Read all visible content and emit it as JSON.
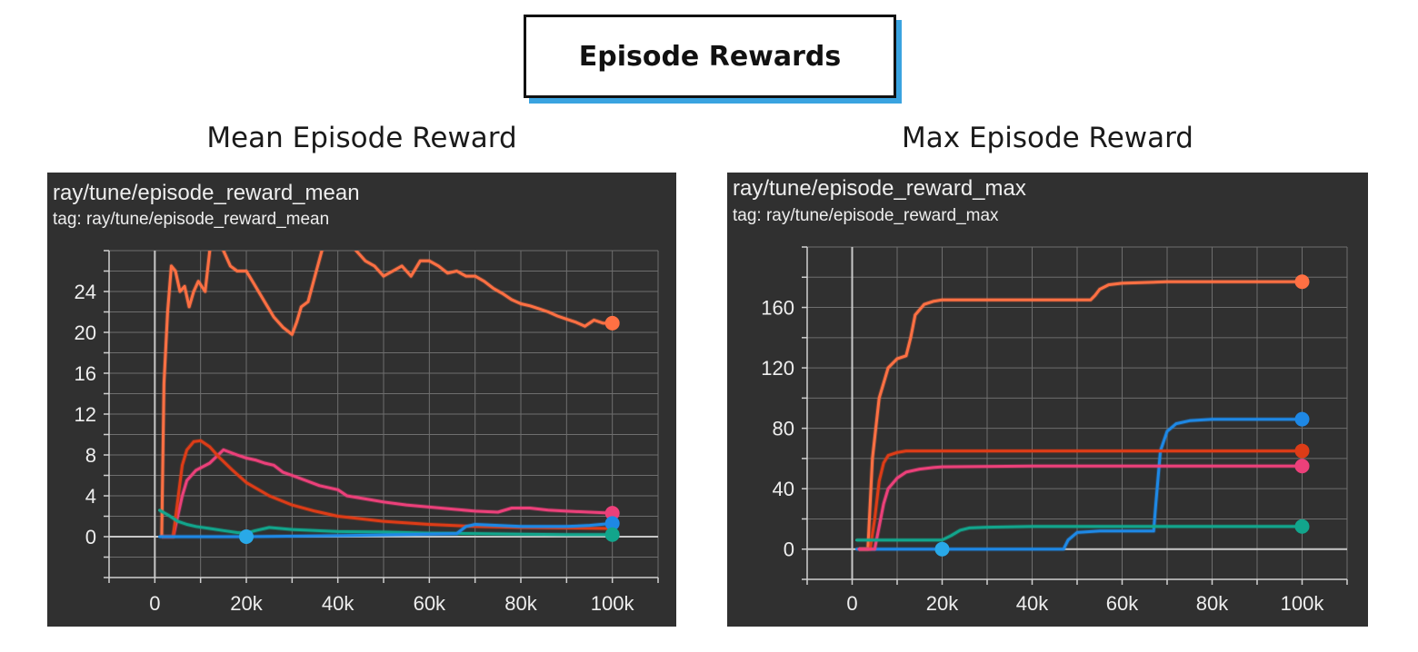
{
  "header": {
    "title": "Episode Rewards"
  },
  "colors": {
    "panel_bg": "#303030",
    "grid": "#6e6e6e",
    "axis": "#d0d0d0",
    "text": "#eeeeee",
    "title_shadow": "#3aa3e0"
  },
  "chart_data": [
    {
      "type": "line",
      "heading": "Mean Episode Reward",
      "title": "ray/tune/episode_reward_mean",
      "subtitle": "tag: ray/tune/episode_reward_mean",
      "xlim": [
        -10000,
        110000
      ],
      "ylim": [
        -4,
        28
      ],
      "x_ticks": [
        0,
        20000,
        40000,
        60000,
        80000,
        100000
      ],
      "x_tick_labels": [
        "0",
        "20k",
        "40k",
        "60k",
        "80k",
        "100k"
      ],
      "y_ticks": [
        0,
        4,
        8,
        12,
        16,
        20,
        24
      ],
      "y_tick_labels": [
        "0",
        "4",
        "8",
        "12",
        "16",
        "20",
        "24"
      ],
      "grid": true,
      "series": [
        {
          "color": "#ff7043",
          "x": [
            1500,
            2000,
            2800,
            3600,
            4500,
            5500,
            6500,
            7500,
            8500,
            9500,
            11000,
            12500,
            13500,
            15000,
            16500,
            18000,
            20000,
            22000,
            24000,
            26000,
            28000,
            30000,
            31000,
            32000,
            33500,
            35000,
            36500,
            38000,
            40000,
            42000,
            44000,
            46000,
            48000,
            50000,
            52000,
            54000,
            56000,
            58000,
            60000,
            62000,
            64000,
            66000,
            68000,
            70000,
            72000,
            74000,
            76000,
            78000,
            80000,
            82000,
            84000,
            86000,
            88000,
            90000,
            92000,
            94000,
            96000,
            98000,
            100000
          ],
          "y": [
            0,
            15,
            22,
            26.5,
            26,
            24,
            24.5,
            22.5,
            24,
            25,
            24,
            30,
            32,
            28,
            26.5,
            26,
            26,
            24.5,
            23,
            21.5,
            20.5,
            19.8,
            21,
            22.5,
            23,
            25.5,
            28,
            32,
            32,
            30,
            28,
            27,
            26.5,
            25.5,
            26,
            26.5,
            25.5,
            27,
            27,
            26.5,
            25.8,
            26,
            25.5,
            25.5,
            25,
            24.3,
            23.8,
            23.2,
            22.8,
            22.6,
            22.3,
            22,
            21.6,
            21.3,
            21,
            20.6,
            21.2,
            20.9,
            20.9
          ]
        },
        {
          "color": "#ec407a",
          "x": [
            1500,
            4000,
            5000,
            6000,
            7000,
            9000,
            12000,
            15000,
            18000,
            20000,
            22000,
            24000,
            26000,
            28000,
            30000,
            33000,
            36000,
            40000,
            42000,
            46000,
            50000,
            55000,
            60000,
            65000,
            70000,
            75000,
            78000,
            82000,
            86000,
            90000,
            95000,
            100000
          ],
          "y": [
            0,
            0,
            2,
            4,
            5.5,
            6.5,
            7.2,
            8.5,
            8.0,
            7.7,
            7.5,
            7.2,
            7.0,
            6.3,
            6.0,
            5.5,
            5.0,
            4.6,
            4.0,
            3.7,
            3.4,
            3.1,
            2.9,
            2.7,
            2.5,
            2.4,
            2.8,
            2.8,
            2.6,
            2.5,
            2.4,
            2.3
          ]
        },
        {
          "color": "#dd3c17",
          "x": [
            1500,
            4000,
            5000,
            6000,
            7000,
            8500,
            10000,
            12000,
            14000,
            17000,
            20000,
            25000,
            30000,
            35000,
            40000,
            50000,
            60000,
            70000,
            80000,
            90000,
            100000
          ],
          "y": [
            0,
            0,
            3.5,
            7.0,
            8.5,
            9.3,
            9.4,
            8.8,
            7.8,
            6.5,
            5.3,
            4.0,
            3.1,
            2.5,
            2.0,
            1.5,
            1.2,
            1.0,
            0.9,
            0.85,
            0.8
          ]
        },
        {
          "color": "#12a58c",
          "x": [
            1000,
            3000,
            5000,
            7000,
            9000,
            12000,
            15000,
            18000,
            20000,
            22000,
            25000,
            30000,
            40000,
            50000,
            60000,
            70000,
            80000,
            90000,
            100000
          ],
          "y": [
            2.6,
            2.1,
            1.5,
            1.2,
            1.0,
            0.8,
            0.6,
            0.4,
            0.35,
            0.6,
            0.9,
            0.7,
            0.5,
            0.45,
            0.35,
            0.3,
            0.25,
            0.2,
            0.2
          ]
        },
        {
          "color": "#1e88e5",
          "x": [
            1000,
            20000,
            40000,
            60000,
            66000,
            68000,
            70000,
            80000,
            90000,
            95000,
            100000
          ],
          "y": [
            0,
            0,
            0.1,
            0.25,
            0.3,
            1.0,
            1.2,
            1.0,
            1.0,
            1.1,
            1.3
          ]
        }
      ],
      "markers": [
        {
          "x": 100000,
          "y": 20.9,
          "color": "#ff7043"
        },
        {
          "x": 100000,
          "y": 2.3,
          "color": "#ec407a"
        },
        {
          "x": 100000,
          "y": 1.3,
          "color": "#1e88e5"
        },
        {
          "x": 100000,
          "y": 0.2,
          "color": "#12a58c"
        },
        {
          "x": 20000,
          "y": 0,
          "color": "#29a9e8"
        }
      ]
    },
    {
      "type": "line",
      "heading": "Max Episode Reward",
      "title": "ray/tune/episode_reward_max",
      "subtitle": "tag: ray/tune/episode_reward_max",
      "xlim": [
        -10000,
        110000
      ],
      "ylim": [
        -20,
        200
      ],
      "x_ticks": [
        0,
        20000,
        40000,
        60000,
        80000,
        100000
      ],
      "x_tick_labels": [
        "0",
        "20k",
        "40k",
        "60k",
        "80k",
        "100k"
      ],
      "y_ticks": [
        0,
        40,
        80,
        120,
        160
      ],
      "y_tick_labels": [
        "0",
        "40",
        "80",
        "120",
        "160"
      ],
      "grid": true,
      "series": [
        {
          "color": "#ff7043",
          "x": [
            1500,
            3500,
            4500,
            6000,
            8000,
            10000,
            12000,
            13000,
            14000,
            16000,
            18000,
            20000,
            25000,
            30000,
            40000,
            50000,
            53000,
            54000,
            55000,
            57000,
            60000,
            70000,
            80000,
            90000,
            100000
          ],
          "y": [
            0,
            0,
            60,
            100,
            120,
            126,
            128,
            140,
            155,
            162,
            164,
            165,
            165,
            165,
            165,
            165,
            165,
            168,
            172,
            175,
            176,
            177,
            177,
            177,
            177
          ]
        },
        {
          "color": "#1e88e5",
          "x": [
            1000,
            20000,
            40000,
            47000,
            48000,
            50000,
            55000,
            67000,
            67500,
            68500,
            70000,
            72000,
            75000,
            80000,
            90000,
            100000
          ],
          "y": [
            0,
            0,
            0,
            0,
            6,
            11,
            12,
            12,
            30,
            65,
            78,
            83,
            85,
            86,
            86,
            86
          ]
        },
        {
          "color": "#dd3c17",
          "x": [
            1500,
            4000,
            5000,
            6000,
            7000,
            8000,
            10000,
            12000,
            15000,
            20000,
            40000,
            60000,
            80000,
            100000
          ],
          "y": [
            0,
            0,
            20,
            45,
            57,
            62,
            64,
            65,
            65,
            65,
            65,
            65,
            65,
            65
          ]
        },
        {
          "color": "#ec407a",
          "x": [
            1500,
            5000,
            6000,
            7000,
            8000,
            10000,
            12000,
            15000,
            18000,
            20000,
            40000,
            60000,
            80000,
            100000
          ],
          "y": [
            0,
            0,
            15,
            30,
            40,
            47,
            51,
            53,
            54,
            54.5,
            55,
            55,
            55,
            55
          ]
        },
        {
          "color": "#12a58c",
          "x": [
            1000,
            10000,
            18000,
            20000,
            22000,
            24000,
            26000,
            30000,
            40000,
            60000,
            80000,
            100000
          ],
          "y": [
            6,
            6,
            6,
            6,
            9,
            12.5,
            14,
            14.5,
            15,
            15,
            15,
            15
          ]
        }
      ],
      "markers": [
        {
          "x": 100000,
          "y": 177,
          "color": "#ff7043"
        },
        {
          "x": 100000,
          "y": 86,
          "color": "#1e88e5"
        },
        {
          "x": 100000,
          "y": 65,
          "color": "#dd3c17"
        },
        {
          "x": 100000,
          "y": 55,
          "color": "#ec407a"
        },
        {
          "x": 100000,
          "y": 15,
          "color": "#12a58c"
        },
        {
          "x": 20000,
          "y": 0,
          "color": "#29a9e8"
        }
      ]
    }
  ]
}
